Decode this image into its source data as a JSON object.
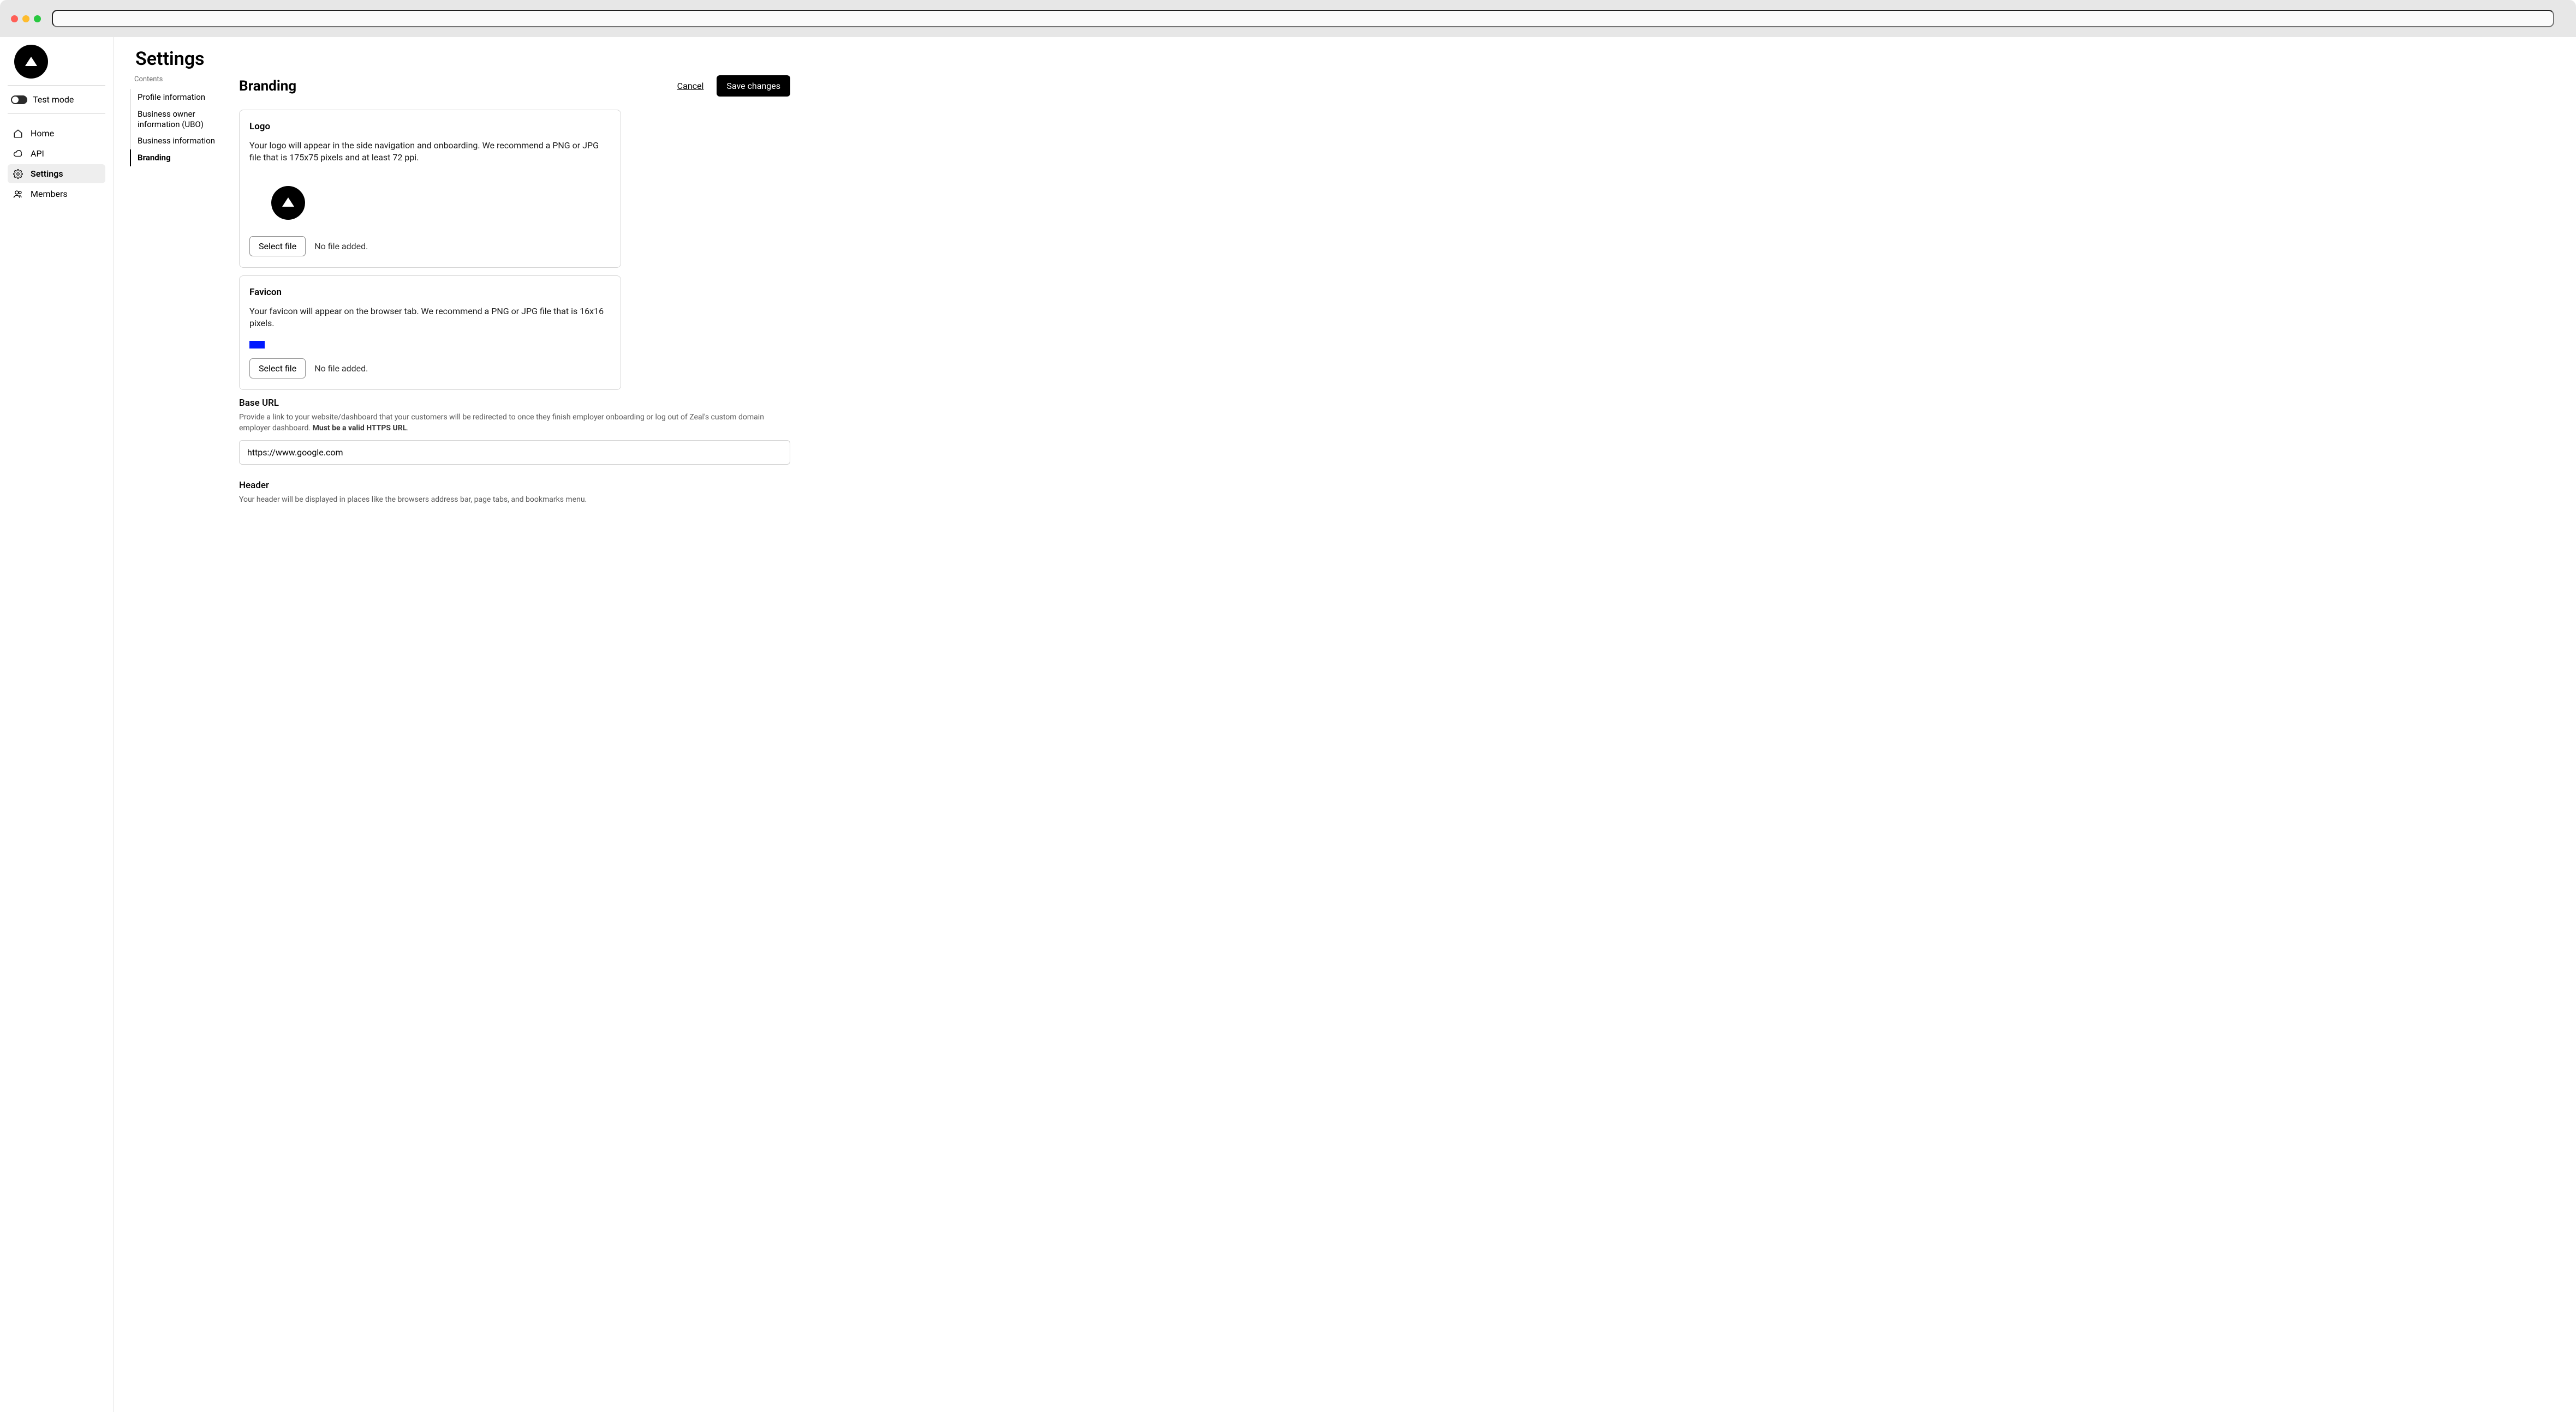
{
  "titlebar": {
    "url_value": ""
  },
  "sidebar": {
    "test_mode_label": "Test mode",
    "nav": [
      {
        "key": "home",
        "label": "Home"
      },
      {
        "key": "api",
        "label": "API"
      },
      {
        "key": "settings",
        "label": "Settings"
      },
      {
        "key": "members",
        "label": "Members"
      }
    ]
  },
  "page": {
    "title": "Settings",
    "contents_heading": "Contents",
    "contents": [
      {
        "key": "profile",
        "label": "Profile information"
      },
      {
        "key": "ubo",
        "label": "Business owner information (UBO)"
      },
      {
        "key": "business",
        "label": "Business information"
      },
      {
        "key": "branding",
        "label": "Branding"
      }
    ]
  },
  "branding": {
    "section_title": "Branding",
    "cancel_label": "Cancel",
    "save_label": "Save changes",
    "logo": {
      "title": "Logo",
      "desc": "Your logo will appear in the side navigation and onboarding. We recommend a PNG or JPG file that is 175x75 pixels and at least 72 ppi.",
      "select_label": "Select file",
      "status": "No file added."
    },
    "favicon": {
      "title": "Favicon",
      "desc": "Your favicon will appear on the browser tab. We recommend a PNG or JPG file that is 16x16 pixels.",
      "select_label": "Select file",
      "status": "No file added."
    },
    "base_url": {
      "label": "Base URL",
      "desc_pre": "Provide a link to your website/dashboard that your customers will be redirected to once they finish employer onboarding or log out of Zeal's custom domain employer dashboard. ",
      "desc_bold": "Must be a valid HTTPS URL",
      "desc_post": ".",
      "value": "https://www.google.com"
    },
    "header": {
      "label": "Header",
      "desc": "Your header will be displayed in places like the browsers address bar, page tabs, and bookmarks menu."
    }
  }
}
